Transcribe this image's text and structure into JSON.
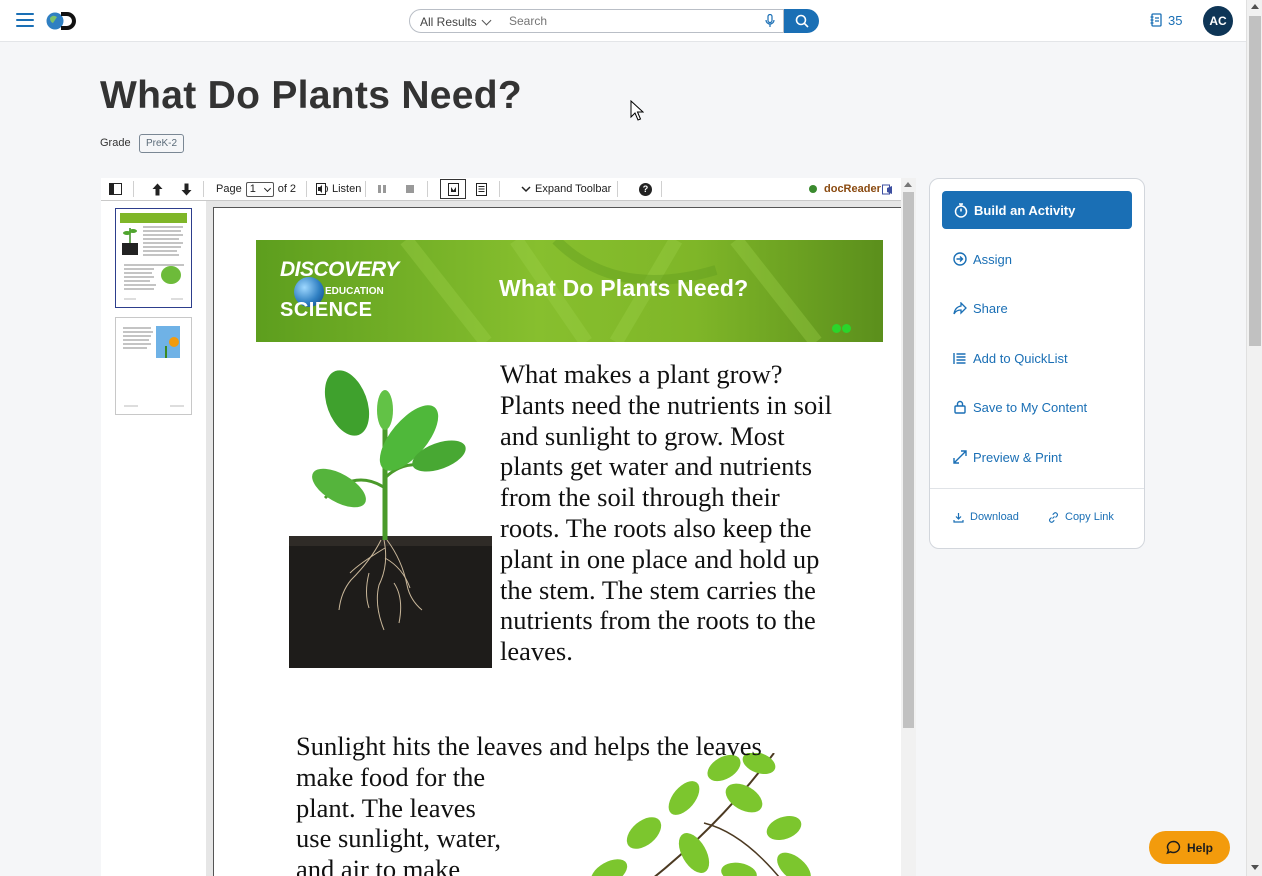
{
  "header": {
    "search_scope": "All Results",
    "search_placeholder": "Search",
    "counter": "35",
    "avatar_initials": "AC"
  },
  "page": {
    "title": "What Do Plants Need?",
    "grade_label": "Grade",
    "grade_value": "PreK-2"
  },
  "viewer": {
    "toolbar": {
      "page_label": "Page",
      "page_value": "1",
      "page_of": "of 2",
      "listen": "Listen",
      "expand_toolbar": "Expand Toolbar",
      "help": "?",
      "brand": "docReader"
    },
    "document": {
      "banner_title": "What Do Plants Need?",
      "brand_line1": "DISCOVERY",
      "brand_line2": "EDUCATION",
      "brand_line3": "SCIENCE",
      "paragraph1": "What makes a plant grow? Plants need the nutrients in soil and sunlight to grow. Most plants get water and nutrients from the soil through their roots. The roots also keep the plant in one place and hold up the stem. The stem carries the nutrients from the roots to the leaves.",
      "paragraph2_lines": [
        "Sunlight hits the leaves and helps the leaves",
        "make food for the",
        "plant. The leaves",
        "use sunlight, water,",
        "and air to make"
      ]
    },
    "current_page": 1,
    "total_pages": 2
  },
  "side_panel": {
    "primary": "Build an Activity",
    "actions": [
      "Assign",
      "Share",
      "Add to QuickList",
      "Save to My Content",
      "Preview & Print"
    ],
    "download": "Download",
    "copy_link": "Copy Link"
  },
  "help_button": "Help",
  "colors": {
    "brand_blue": "#1a6fb5",
    "help_orange": "#f39b0c",
    "banner_green": "#7fb628",
    "avatar_navy": "#0e3556"
  }
}
